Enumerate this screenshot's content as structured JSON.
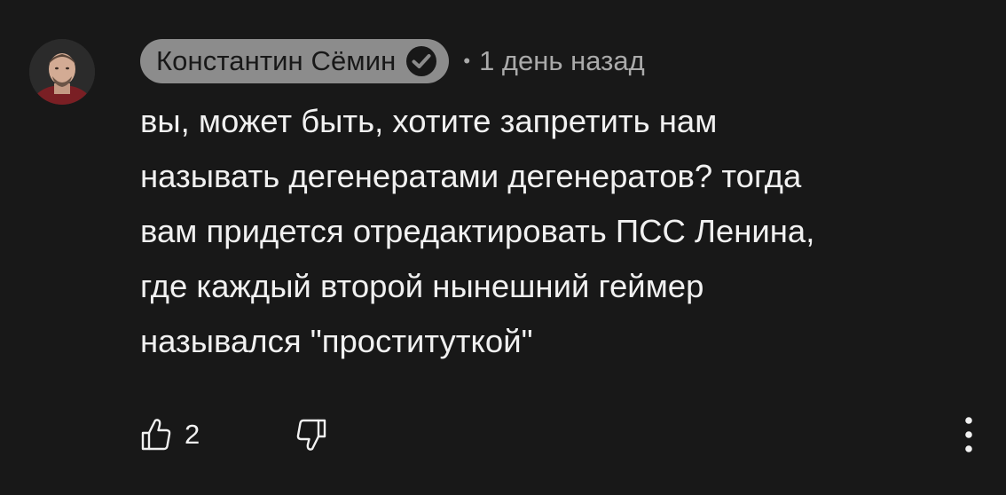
{
  "comment": {
    "author": "Константин Сёмин",
    "author_verified": true,
    "separator": "•",
    "timestamp": "1 день назад",
    "text": "вы, может быть, хотите запретить нам\nназывать дегенератами дегенератов? тогда\nвам придется отредактировать ПСС Ленина,\nгде каждый второй нынешний геймер\nназывался \"проституткой\"",
    "like_count": "2"
  },
  "icons": {
    "avatar": "avatar",
    "verified": "checkmark-circle-icon",
    "like": "thumbs-up-icon",
    "dislike": "thumbs-down-icon",
    "more": "more-vertical-icon"
  },
  "colors": {
    "background": "#181818",
    "text": "#f1f1f1",
    "secondary_text": "#aaaaaa",
    "author_chip": "#8c8c8c"
  }
}
